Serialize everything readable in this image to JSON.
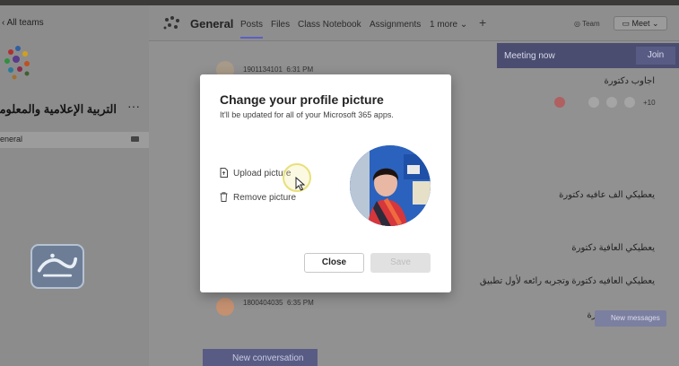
{
  "sidebar": {
    "all_teams": "All teams",
    "team_name": "التربية الإعلامية والمعلوما",
    "more": "···",
    "channel": "eneral"
  },
  "header": {
    "channel_title": "General",
    "tabs": [
      "Posts",
      "Files",
      "Class Notebook",
      "Assignments",
      "1 more ⌄"
    ],
    "plus": "+",
    "team_label": "Team",
    "meet_label": "Meet"
  },
  "banner": {
    "label": "Meeting now",
    "join": "Join"
  },
  "feed": {
    "top_meta": {
      "id": "1901134101",
      "time": "6:31 PM"
    },
    "reply_top": "اجاوب دكتورة",
    "reaction_count": "+10",
    "messages": [
      "يعطيكي الف عافيه دكتورة",
      "يعطيكي العافية دكتورة",
      "يعطيكي العافيه دكتورة  وتجربه رائعه لأول تطبيق"
    ],
    "bottom_meta": {
      "id": "1800404035",
      "time": "6:35 PM"
    },
    "bottom_reply": "دكتورة",
    "new_messages": "New messages",
    "new_conversation": "New conversation"
  },
  "dialog": {
    "title": "Change your profile picture",
    "subtitle": "It'll be updated for all of your Microsoft 365 apps.",
    "upload": "Upload picture",
    "remove": "Remove picture",
    "close": "Close",
    "save": "Save"
  },
  "colors": {
    "accent": "#5b5fc7",
    "banner": "#4a4d70"
  }
}
